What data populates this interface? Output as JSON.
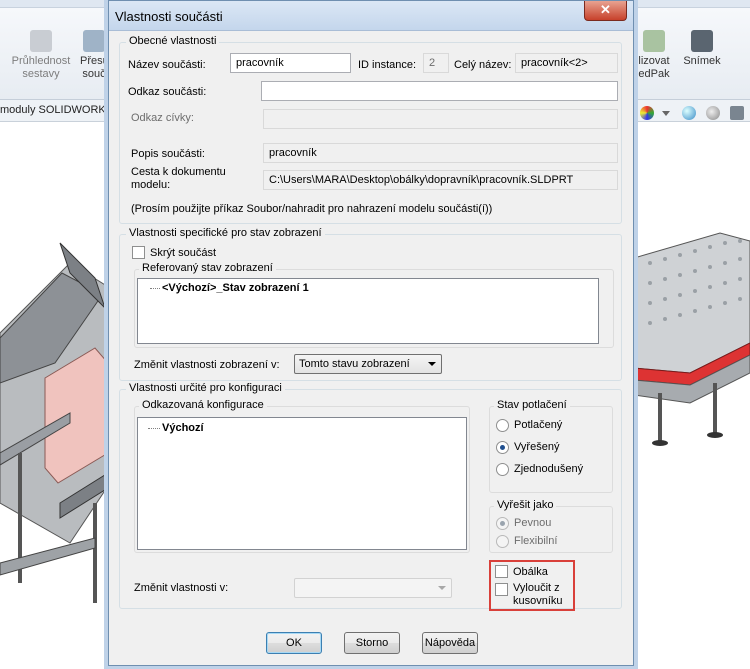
{
  "background_app": {
    "toolbar": {
      "transparency_label": "Průhlednost\nsestavy",
      "move_label": "Přesu\nsouč",
      "visualize_label": "lizovat\nedPak",
      "snapshot_label": "Snímek"
    },
    "tab_label": "moduly SOLIDWORKS"
  },
  "dialog": {
    "title": "Vlastnosti součásti",
    "close_symbol": "✕",
    "general": {
      "legend": "Obecné vlastnosti",
      "name_label": "Název součásti:",
      "name_value": "pracovník",
      "instance_label": "ID instance:",
      "instance_value": "2",
      "fullname_label": "Celý název:",
      "fullname_value": "pracovník<2>",
      "ref_label": "Odkaz součásti:",
      "ref_value": "",
      "coil_label": "Odkaz cívky:",
      "coil_value": "",
      "desc_label": "Popis součásti:",
      "desc_value": "pracovník",
      "path_label_1": "Cesta k dokumentu",
      "path_label_2": "modelu:",
      "path_value": "C:\\Users\\MARA\\Desktop\\obálky\\dopravník\\pracovník.SLDPRT",
      "hint": "(Prosím použijte příkaz Soubor/nahradit pro nahrazení modelu součásti(í))"
    },
    "display_state": {
      "legend": "Vlastnosti specifické pro stav zobrazení",
      "hide_label": "Skrýt součást",
      "ref_state_legend": "Referovaný stav zobrazení",
      "tree_item_bold": "<Výchozí>",
      "tree_item_rest": "_Stav zobrazení 1",
      "change_label": "Změnit vlastnosti zobrazení v:",
      "change_value": "Tomto stavu zobrazení"
    },
    "configuration": {
      "legend": "Vlastnosti určité pro konfiguraci",
      "ref_config_legend": "Odkazovaná konfigurace",
      "tree_item": "Výchozí",
      "suppression_legend": "Stav potlačení",
      "suppressed": "Potlačený",
      "resolved": "Vyřešený",
      "simplified": "Zjednodušený",
      "solve_as_legend": "Vyřešit jako",
      "rigid": "Pevnou",
      "flexible": "Flexibilní",
      "envelope": "Obálka",
      "exclude_1": "Vyloučit z",
      "exclude_2": "kusovníku",
      "change_label": "Změnit vlastnosti v:",
      "change_value": ""
    },
    "buttons": {
      "ok": "OK",
      "cancel": "Storno",
      "help": "Nápověda"
    }
  }
}
